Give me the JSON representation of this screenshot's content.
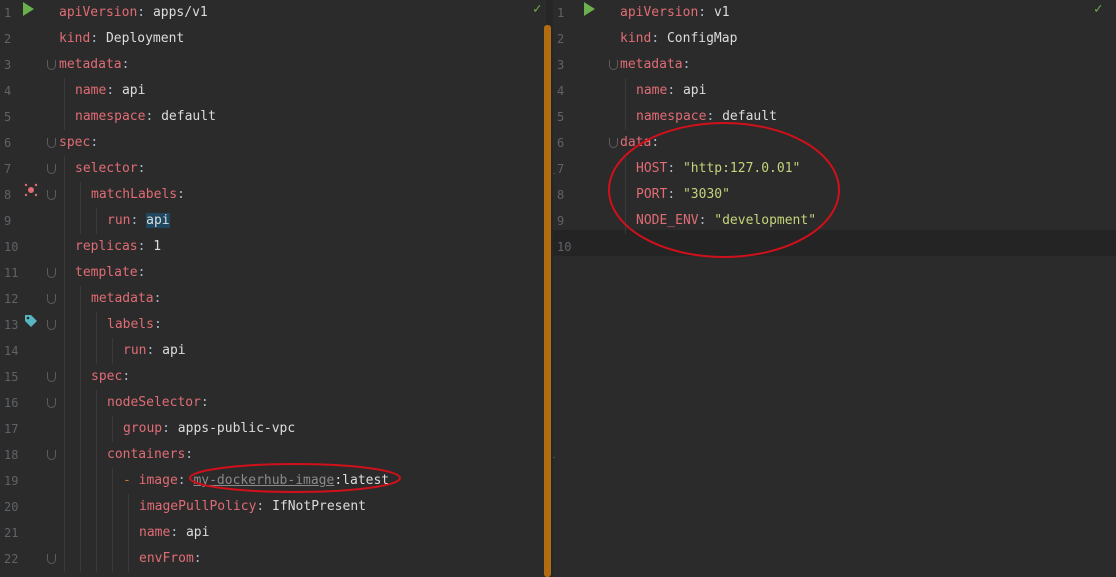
{
  "left": {
    "lines": [
      {
        "n": "1",
        "indent": 0,
        "key": "apiVersion",
        "val": "apps/v1"
      },
      {
        "n": "2",
        "indent": 0,
        "key": "kind",
        "val": "Deployment"
      },
      {
        "n": "3",
        "indent": 0,
        "key": "metadata",
        "val": ""
      },
      {
        "n": "4",
        "indent": 1,
        "key": "name",
        "val": "api"
      },
      {
        "n": "5",
        "indent": 1,
        "key": "namespace",
        "val": "default"
      },
      {
        "n": "6",
        "indent": 0,
        "key": "spec",
        "val": ""
      },
      {
        "n": "7",
        "indent": 1,
        "key": "selector",
        "val": ""
      },
      {
        "n": "8",
        "indent": 2,
        "key": "matchLabels",
        "val": ""
      },
      {
        "n": "9",
        "indent": 3,
        "key": "run",
        "val": "api",
        "selected": true
      },
      {
        "n": "10",
        "indent": 1,
        "key": "replicas",
        "val": "1"
      },
      {
        "n": "11",
        "indent": 1,
        "key": "template",
        "val": ""
      },
      {
        "n": "12",
        "indent": 2,
        "key": "metadata",
        "val": ""
      },
      {
        "n": "13",
        "indent": 3,
        "key": "labels",
        "val": ""
      },
      {
        "n": "14",
        "indent": 4,
        "key": "run",
        "val": "api"
      },
      {
        "n": "15",
        "indent": 2,
        "key": "spec",
        "val": ""
      },
      {
        "n": "16",
        "indent": 3,
        "key": "nodeSelector",
        "val": ""
      },
      {
        "n": "17",
        "indent": 4,
        "key": "group",
        "val": "apps-public-vpc"
      },
      {
        "n": "18",
        "indent": 3,
        "key": "containers",
        "val": ""
      },
      {
        "n": "19",
        "indent": 4,
        "key": "image",
        "dash": true,
        "val_underlined": "my-dockerhub-image",
        "val": ":latest"
      },
      {
        "n": "20",
        "indent": 5,
        "key": "imagePullPolicy",
        "val": "IfNotPresent"
      },
      {
        "n": "21",
        "indent": 5,
        "key": "name",
        "val": "api"
      },
      {
        "n": "22",
        "indent": 5,
        "key": "envFrom",
        "val": ""
      }
    ]
  },
  "right": {
    "lines": [
      {
        "n": "1",
        "indent": 0,
        "key": "apiVersion",
        "val": "v1"
      },
      {
        "n": "2",
        "indent": 0,
        "key": "kind",
        "val": "ConfigMap"
      },
      {
        "n": "3",
        "indent": 0,
        "key": "metadata",
        "val": ""
      },
      {
        "n": "4",
        "indent": 1,
        "key": "name",
        "val": "api"
      },
      {
        "n": "5",
        "indent": 1,
        "key": "namespace",
        "val": "default"
      },
      {
        "n": "6",
        "indent": 0,
        "key": "data",
        "val": ""
      },
      {
        "n": "7",
        "indent": 1,
        "key": "HOST",
        "val": "\"http:127.0.01\"",
        "str": true
      },
      {
        "n": "8",
        "indent": 1,
        "key": "PORT",
        "val": "\"3030\"",
        "str": true
      },
      {
        "n": "9",
        "indent": 1,
        "key": "NODE_ENV",
        "val": "\"development\"",
        "str": true
      },
      {
        "n": "10",
        "indent": 0,
        "key": "",
        "val": ""
      }
    ]
  },
  "icons": {
    "run": "run-icon",
    "check": "check-icon",
    "bug": "debug-icon",
    "tag": "tag-icon"
  },
  "colors": {
    "background": "#2b2b2b",
    "key": "#e06c75",
    "string": "#c3d47a",
    "accent_run": "#6ab04c",
    "scrollbar": "#b26d12",
    "annotation": "#d0101a"
  }
}
